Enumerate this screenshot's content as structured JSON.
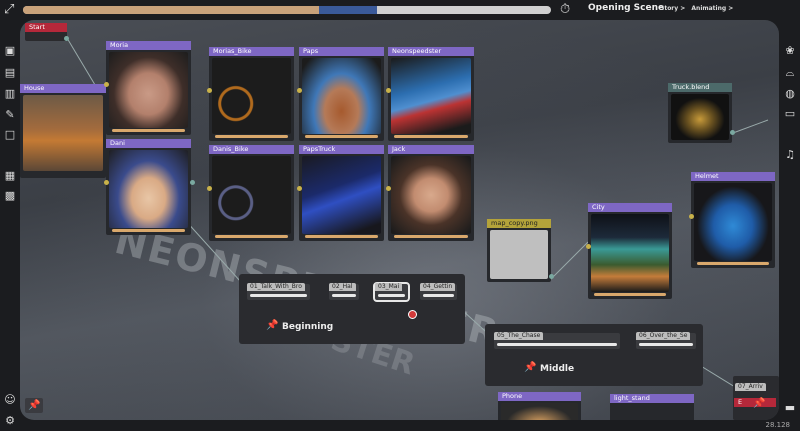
{
  "topbar": {
    "app_icon": "graph-icon",
    "progress_done": 0.56,
    "progress_current": 0.11,
    "timer_icon": "stopwatch-icon",
    "scene_title": "Opening Scene",
    "breadcrumbs": [
      "Story >",
      "Animating >"
    ]
  },
  "left_sidebar": [
    "add-image-icon",
    "image-settings-icon",
    "clipboard-icon",
    "pin-icon",
    "frame-icon",
    "printer-icon",
    "clapperboard-icon"
  ],
  "left_bottom": [
    "users-icon",
    "gear-icon"
  ],
  "right_sidebar": [
    "brain-icon",
    "car-icon",
    "globe-icon",
    "archive-icon",
    "music-icon"
  ],
  "right_bottom": [
    "folder-icon"
  ],
  "nodes": {
    "start": "Start",
    "house": "House",
    "moria": "Moria",
    "dani": "Dani",
    "morias_bike": "Morias_Bike",
    "danis_bike": "Danis_Bike",
    "paps": "Paps",
    "paps_truck": "PapsTruck",
    "neonspeedster": "Neonspeedster",
    "jack": "Jack",
    "truck_blend": "Truck.blend",
    "map_copy": "map_copy.png",
    "city": "City",
    "helmet": "Helmet",
    "phone": "Phone",
    "light_stand": "light_stand",
    "arrive": "07_Arriv",
    "end": "E"
  },
  "groups": {
    "beginning": {
      "label": "Beginning",
      "steps": [
        "01_Talk_With_Bro",
        "02_Hal",
        "03_Mai",
        "04_Gettin"
      ]
    },
    "middle": {
      "label": "Middle",
      "steps": [
        "05_The_Chase",
        "06_Over_the_Se"
      ]
    }
  },
  "background_text": [
    "NEONSPEEDSTER",
    "STER"
  ],
  "version": "28.128"
}
